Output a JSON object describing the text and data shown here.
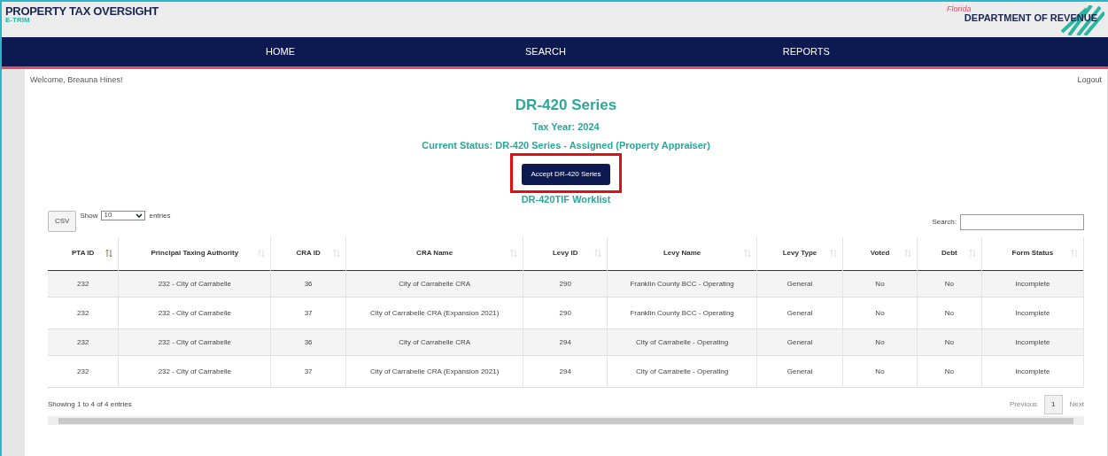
{
  "header": {
    "title": "PROPERTY TAX OVERSIGHT",
    "subtitle": "E-TRIM",
    "logo_script": "Florida",
    "logo_text": "DEPARTMENT OF REVENUE"
  },
  "nav": [
    "HOME",
    "SEARCH",
    "REPORTS"
  ],
  "welcome": "Welcome, Breauna Hines!",
  "logout": "Logout",
  "heading": {
    "title": "DR-420 Series",
    "tax_year": "Tax Year: 2024",
    "status": "Current Status: DR-420 Series - Assigned (Property Appraiser)"
  },
  "accept_button": {
    "label": "Accept DR-420 Series",
    "highlighted": true
  },
  "worklist_title": "DR-420TIF Worklist",
  "controls": {
    "csv": "CSV",
    "show": "Show",
    "page_size": "10",
    "entries": "entries",
    "search_label": "Search:"
  },
  "table": {
    "columns": [
      {
        "label": "PTA ID",
        "sorted": true
      },
      {
        "label": "Principal Taxing Authority",
        "sorted": false
      },
      {
        "label": "CRA ID",
        "sorted": false
      },
      {
        "label": "CRA Name",
        "sorted": false
      },
      {
        "label": "Levy ID",
        "sorted": false
      },
      {
        "label": "Levy Name",
        "sorted": false
      },
      {
        "label": "Levy Type",
        "sorted": false
      },
      {
        "label": "Voted",
        "sorted": false
      },
      {
        "label": "Debt",
        "sorted": false
      },
      {
        "label": "Form Status",
        "sorted": false
      }
    ],
    "rows": [
      [
        "232",
        "232 - City of Carrabelle",
        "36",
        "City of Carrabelle CRA",
        "290",
        "Franklin County BCC - Operating",
        "General",
        "No",
        "No",
        "Incomplete"
      ],
      [
        "232",
        "232 - City of Carrabelle",
        "37",
        "City of Carrabelle CRA (Expansion 2021)",
        "290",
        "Franklin County BCC - Operating",
        "General",
        "No",
        "No",
        "Incomplete"
      ],
      [
        "232",
        "232 - City of Carrabelle",
        "36",
        "City of Carrabelle CRA",
        "294",
        "City of Carrabelle - Operating",
        "General",
        "No",
        "No",
        "Incomplete"
      ],
      [
        "232",
        "232 - City of Carrabelle",
        "37",
        "City of Carrabelle CRA (Expansion 2021)",
        "294",
        "City of Carrabelle - Operating",
        "General",
        "No",
        "No",
        "Incomplete"
      ]
    ]
  },
  "footer": {
    "info": "Showing 1 to 4 of 4 entries",
    "previous": "Previous",
    "pages": [
      {
        "label": "1",
        "selected": true
      }
    ],
    "next": "Next"
  }
}
